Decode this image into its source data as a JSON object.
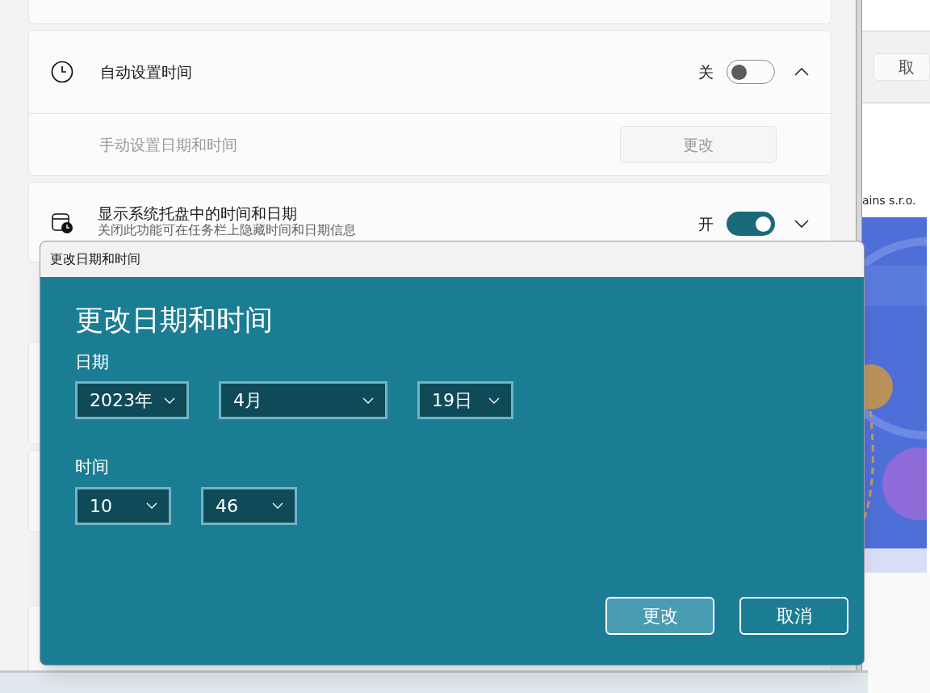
{
  "settings": {
    "auto_time": {
      "label": "自动设置时间",
      "state_text": "关",
      "on": false,
      "expanded": true
    },
    "manual": {
      "label": "手动设置日期和时间",
      "button": "更改",
      "disabled": true
    },
    "tray": {
      "label": "显示系统托盘中的时间和日期",
      "description": "关闭此功能可在任务栏上隐藏时间和日期信息",
      "state_text": "开",
      "on": true,
      "expanded": false
    }
  },
  "browser": {
    "button": "取",
    "text": "ains s.r.o."
  },
  "dialog": {
    "window_title": "更改日期和时间",
    "heading": "更改日期和时间",
    "date_label": "日期",
    "date_fields": [
      {
        "value": "2023年",
        "kind": "year"
      },
      {
        "value": "4月",
        "kind": "month"
      },
      {
        "value": "19日",
        "kind": "day"
      }
    ],
    "time_label": "时间",
    "time_fields": [
      {
        "value": "10",
        "kind": "hour"
      },
      {
        "value": "46",
        "kind": "minute"
      }
    ],
    "buttons": [
      {
        "label": "更改",
        "primary": true
      },
      {
        "label": "取消",
        "primary": false
      }
    ]
  }
}
